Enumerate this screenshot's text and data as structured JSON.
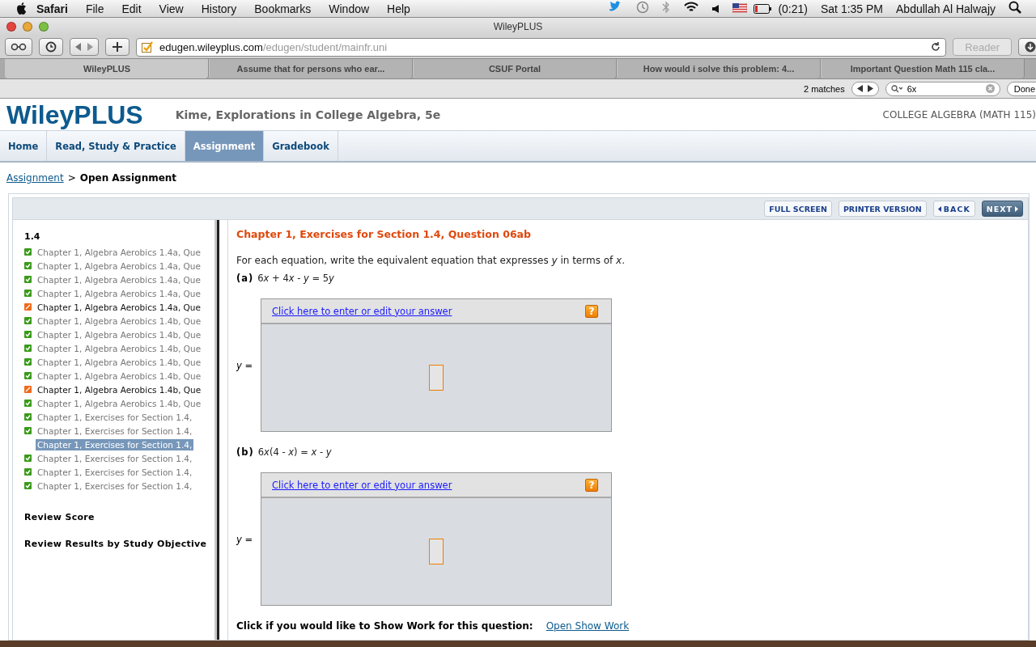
{
  "menubar": {
    "app": "Safari",
    "menus": [
      "File",
      "Edit",
      "View",
      "History",
      "Bookmarks",
      "Window",
      "Help"
    ],
    "battery": "(0:21)",
    "clock": "Sat 1:35 PM",
    "user": "Abdullah Al Halwajy"
  },
  "window": {
    "title": "WileyPLUS"
  },
  "toolbar": {
    "url_host": "edugen.wileyplus.com",
    "url_path": "/edugen/student/mainfr.uni",
    "reader": {
      "label": "Reader",
      "disabled": true
    }
  },
  "tabs": [
    {
      "label": "WileyPLUS",
      "selected": true
    },
    {
      "label": "Assume that for persons who ear...",
      "selected": false
    },
    {
      "label": "CSUF Portal",
      "selected": false
    },
    {
      "label": "How would i solve this problem: 4...",
      "selected": false
    },
    {
      "label": "Important Question Math 115 cla...",
      "selected": false
    }
  ],
  "find_bar": {
    "matches": "2 matches",
    "query": "6x",
    "done": "Done"
  },
  "site": {
    "logo": "WileyPLUS",
    "book": "Kime, Explorations in College Algebra, 5e",
    "course": "COLLEGE ALGEBRA (MATH 115)"
  },
  "nav": [
    {
      "label": "Home",
      "selected": false
    },
    {
      "label": "Read, Study & Practice",
      "selected": false
    },
    {
      "label": "Assignment",
      "selected": true
    },
    {
      "label": "Gradebook",
      "selected": false
    }
  ],
  "breadcrumb": {
    "link": "Assignment",
    "separator": ">",
    "current": "Open Assignment"
  },
  "actions": [
    {
      "label": "FULL SCREEN",
      "kind": "plain"
    },
    {
      "label": "PRINTER VERSION",
      "kind": "plain"
    },
    {
      "label": "BACK",
      "kind": "back"
    },
    {
      "label": "NEXT",
      "kind": "next"
    }
  ],
  "sidebar": {
    "heading": "1.4",
    "items": [
      {
        "label": "Chapter 1, Algebra Aerobics 1.4a, Que",
        "kind": "done",
        "selected": false
      },
      {
        "label": "Chapter 1, Algebra Aerobics 1.4a, Que",
        "kind": "done",
        "selected": false
      },
      {
        "label": "Chapter 1, Algebra Aerobics 1.4a, Que",
        "kind": "done",
        "selected": false
      },
      {
        "label": "Chapter 1, Algebra Aerobics 1.4a, Que",
        "kind": "done",
        "selected": false
      },
      {
        "label": "Chapter 1, Algebra Aerobics 1.4a, Que",
        "kind": "partial",
        "selected": false
      },
      {
        "label": "Chapter 1, Algebra Aerobics 1.4b, Que",
        "kind": "done",
        "selected": false
      },
      {
        "label": "Chapter 1, Algebra Aerobics 1.4b, Que",
        "kind": "done",
        "selected": false
      },
      {
        "label": "Chapter 1, Algebra Aerobics 1.4b, Que",
        "kind": "done",
        "selected": false
      },
      {
        "label": "Chapter 1, Algebra Aerobics 1.4b, Que",
        "kind": "done",
        "selected": false
      },
      {
        "label": "Chapter 1, Algebra Aerobics 1.4b, Que",
        "kind": "done",
        "selected": false
      },
      {
        "label": "Chapter 1, Algebra Aerobics 1.4b, Que",
        "kind": "partial",
        "selected": false
      },
      {
        "label": "Chapter 1, Algebra Aerobics 1.4b, Que",
        "kind": "done",
        "selected": false
      },
      {
        "label": "Chapter 1, Exercises for Section 1.4,",
        "kind": "done",
        "selected": false
      },
      {
        "label": "Chapter 1, Exercises for Section 1.4,",
        "kind": "done",
        "selected": false
      },
      {
        "label": "Chapter 1, Exercises for Section 1.4,",
        "kind": "none",
        "selected": true
      },
      {
        "label": "Chapter 1, Exercises for Section 1.4,",
        "kind": "done",
        "selected": false
      },
      {
        "label": "Chapter 1, Exercises for Section 1.4,",
        "kind": "done",
        "selected": false
      },
      {
        "label": "Chapter 1, Exercises for Section 1.4,",
        "kind": "done",
        "selected": false
      }
    ],
    "links": [
      "Review Score",
      "Review Results by Study Objective"
    ]
  },
  "question": {
    "title": "Chapter 1, Exercises for Section 1.4, Question 06ab",
    "instruction": "For each equation, write the equivalent equation that expresses *y* in terms of *x*.",
    "parts": [
      {
        "label": "(a)",
        "equation": "6x + 4x - y = 5y",
        "answer_label": "*y* =",
        "edit_link": "Click here to enter or edit your answer",
        "help": "?"
      },
      {
        "label": "(b)",
        "equation": "6x(4 - x) = x - y",
        "answer_label": "*y* =",
        "edit_link": "Click here to enter or edit your answer",
        "help": "?"
      }
    ],
    "show_work": {
      "prompt": "Click if you would like to Show Work for this question:",
      "link": "Open Show Work"
    }
  }
}
